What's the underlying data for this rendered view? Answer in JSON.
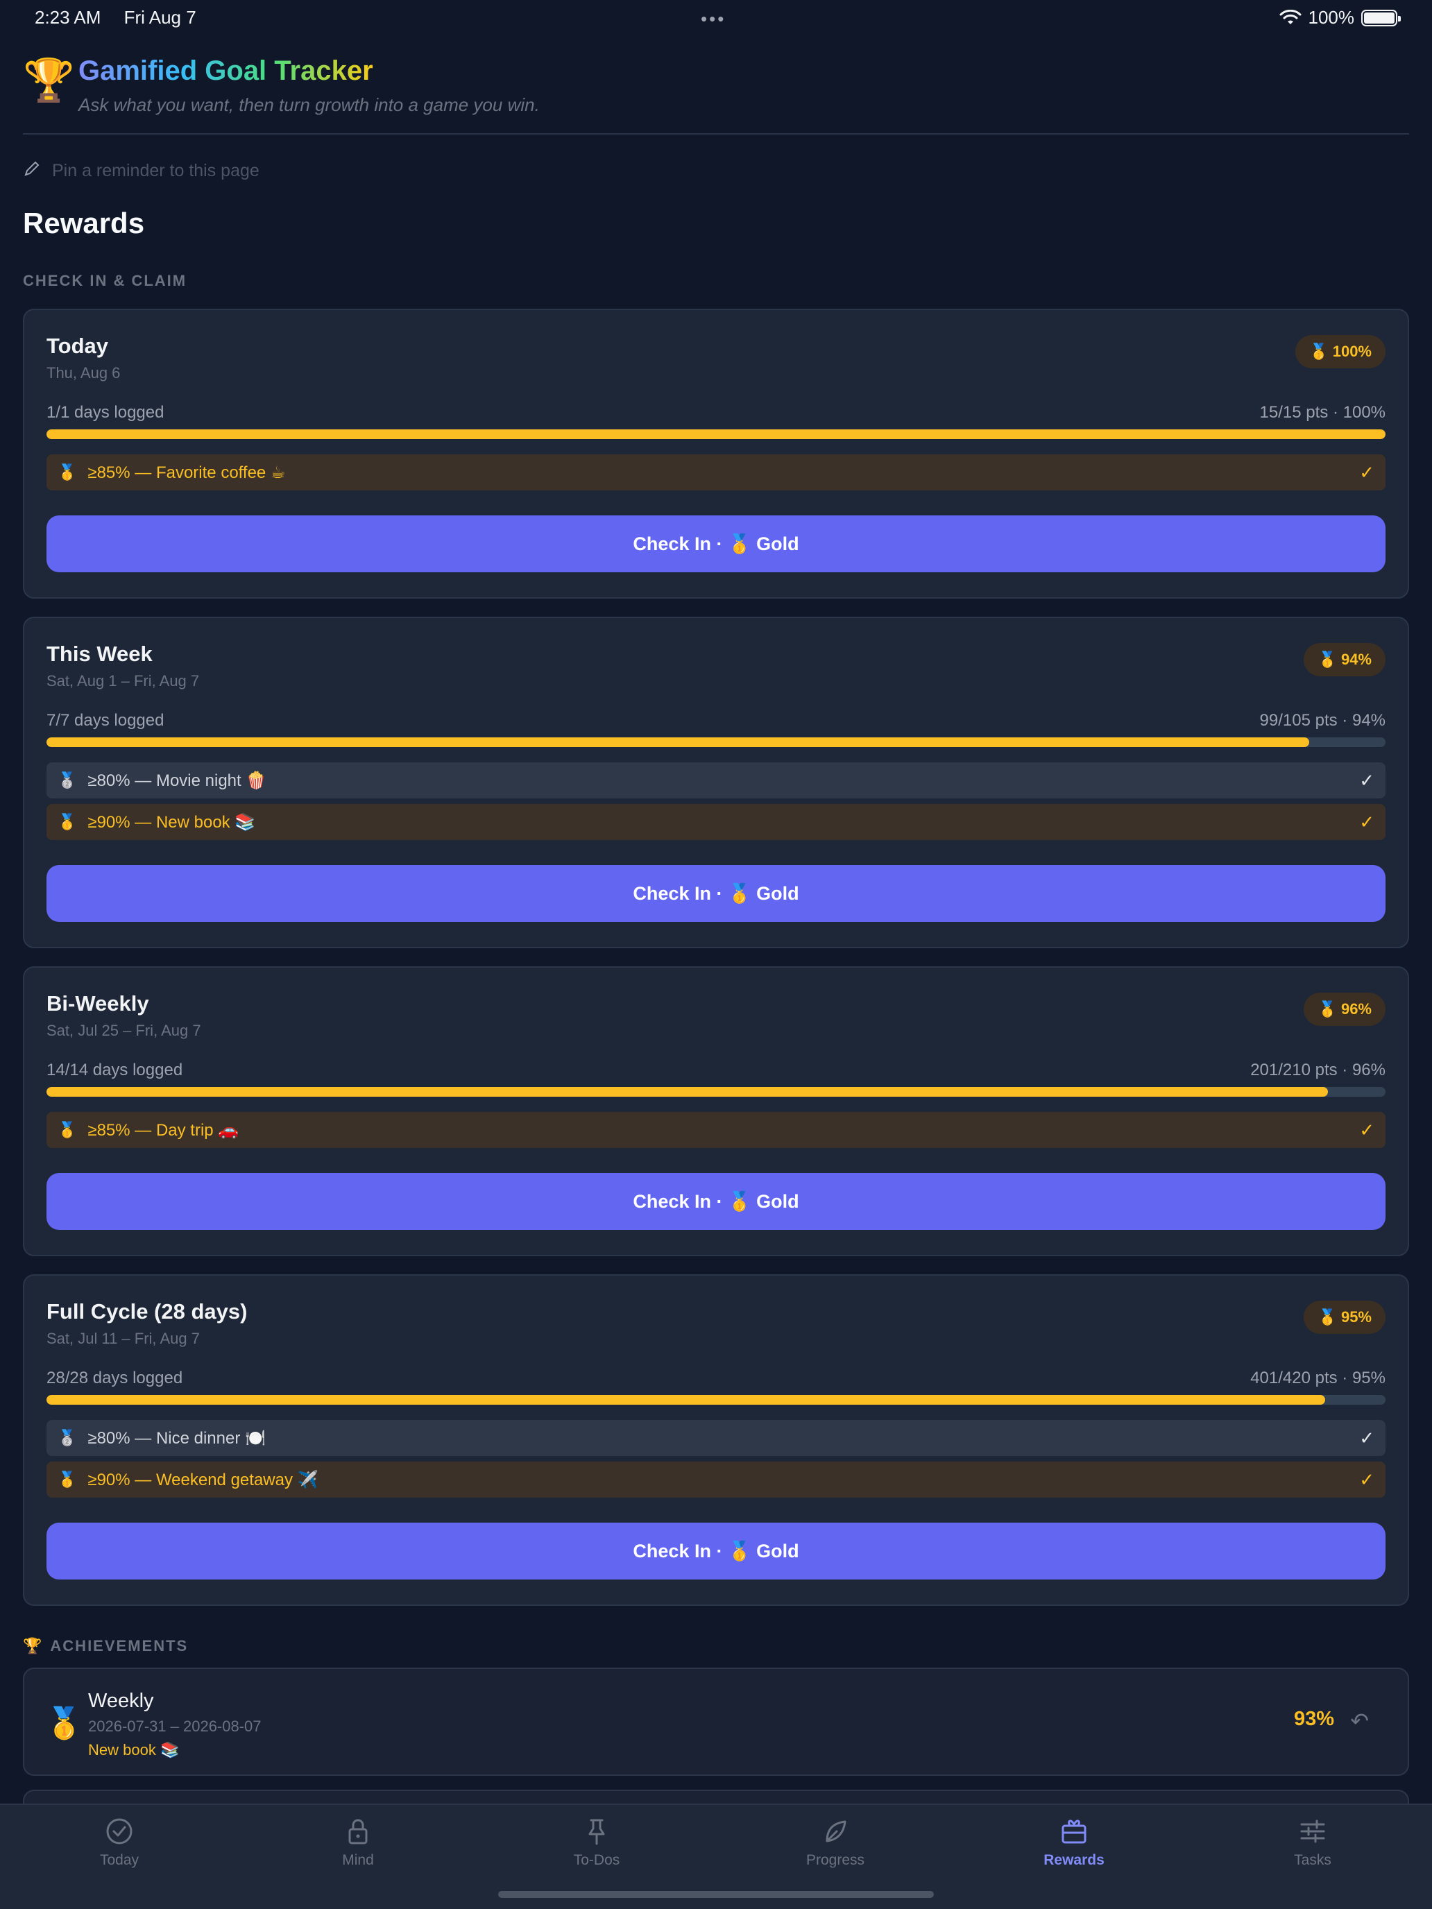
{
  "status_bar": {
    "time": "2:23 AM",
    "date": "Fri Aug 7",
    "battery": "100%"
  },
  "app": {
    "logo": "🏆",
    "title": "Gamified Goal Tracker",
    "tagline": "Ask what you want, then turn growth into a game you win."
  },
  "pin": {
    "icon": "✏️",
    "placeholder": "Pin a reminder to this page"
  },
  "page_title": "Rewards",
  "section_label": "CHECK IN & CLAIM",
  "cards": [
    {
      "title": "Today",
      "date": "Thu, Aug 6",
      "badge": "🥇 100%",
      "days": "1/1 days logged",
      "pts": "15/15 pts · 100%",
      "progress": 1.0,
      "rewards": [
        {
          "medal": "🥇",
          "text": "≥85% — Favorite coffee ☕",
          "tier": "gold",
          "check": "✓"
        }
      ],
      "button": "Check In · 🥇 Gold"
    },
    {
      "title": "This Week",
      "date": "Sat, Aug 1 – Fri, Aug 7",
      "badge": "🥇 94%",
      "days": "7/7 days logged",
      "pts": "99/105 pts · 94%",
      "progress": 0.943,
      "rewards": [
        {
          "medal": "🥈",
          "text": "≥80% — Movie night 🍿",
          "tier": "silver",
          "check": "✓"
        },
        {
          "medal": "🥇",
          "text": "≥90% — New book 📚",
          "tier": "gold",
          "check": "✓"
        }
      ],
      "button": "Check In · 🥇 Gold"
    },
    {
      "title": "Bi-Weekly",
      "date": "Sat, Jul 25 – Fri, Aug 7",
      "badge": "🥇 96%",
      "days": "14/14 days logged",
      "pts": "201/210 pts · 96%",
      "progress": 0.957,
      "rewards": [
        {
          "medal": "🥇",
          "text": "≥85% — Day trip 🚗",
          "tier": "gold",
          "check": "✓"
        }
      ],
      "button": "Check In · 🥇 Gold"
    },
    {
      "title": "Full Cycle (28 days)",
      "date": "Sat, Jul 11 – Fri, Aug 7",
      "badge": "🥇 95%",
      "days": "28/28 days logged",
      "pts": "401/420 pts · 95%",
      "progress": 0.955,
      "rewards": [
        {
          "medal": "🥈",
          "text": "≥80% — Nice dinner 🍽️",
          "tier": "silver",
          "check": "✓"
        },
        {
          "medal": "🥇",
          "text": "≥90% — Weekend getaway ✈️",
          "tier": "gold",
          "check": "✓"
        }
      ],
      "button": "Check In · 🥇 Gold"
    }
  ],
  "achievements": {
    "label_icon": "🏆",
    "label": "ACHIEVEMENTS",
    "items": [
      {
        "medal": "🥇",
        "title": "Weekly",
        "dates": "2026-07-31 – 2026-08-07",
        "reward": "New book 📚",
        "pct": "93%",
        "undo": "↶"
      }
    ]
  },
  "tabs": [
    {
      "label": "Today",
      "icon": "check-circle-icon",
      "active": false
    },
    {
      "label": "Mind",
      "icon": "lock-icon",
      "active": false
    },
    {
      "label": "To-Dos",
      "icon": "pin-icon",
      "active": false
    },
    {
      "label": "Progress",
      "icon": "leaf-icon",
      "active": false
    },
    {
      "label": "Rewards",
      "icon": "gift-icon",
      "active": true
    },
    {
      "label": "Tasks",
      "icon": "sliders-icon",
      "active": false
    }
  ],
  "colors": {
    "accent": "#6366f1",
    "gold": "#fbbf24",
    "background": "#0f1729",
    "card": "#1e2738"
  }
}
